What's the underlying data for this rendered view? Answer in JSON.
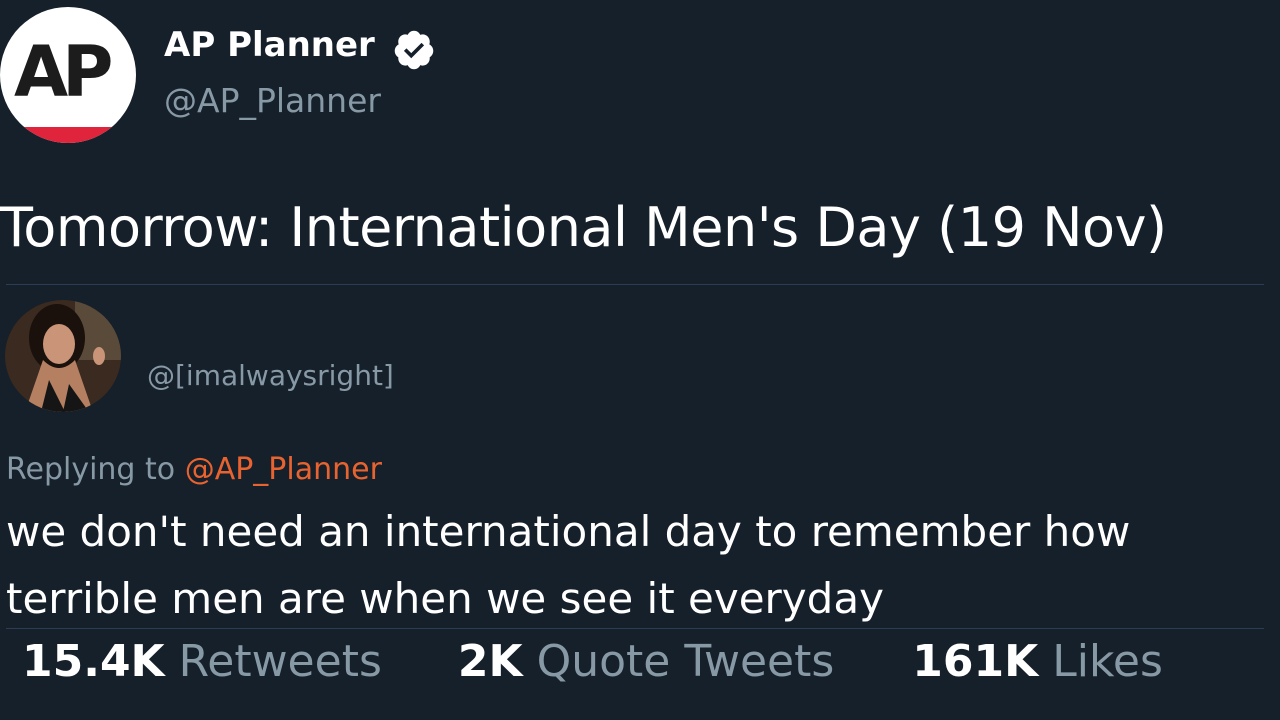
{
  "author": {
    "logo_text": "AP",
    "display_name": "AP Planner",
    "handle": "@AP_Planner",
    "verified_icon": "verified-badge-icon"
  },
  "tweet": {
    "text": "Tomorrow: International Men's Day (19 Nov)"
  },
  "reply": {
    "handle": "@[imalwaysright]",
    "replying_prefix": "Replying to",
    "replying_mention": "@AP_Planner",
    "line1": "we don't need an international day to remember how",
    "line2": "terrible men are when we see it everyday"
  },
  "stats": {
    "retweets_value": "15.4K",
    "retweets_label": "Retweets",
    "quotes_value": "2K",
    "quotes_label": "Quote Tweets",
    "likes_value": "161K",
    "likes_label": "Likes"
  },
  "colors": {
    "background": "#15202b",
    "secondary_text": "#8899a6",
    "mention": "#e8632f",
    "ap_red": "#e0243b"
  }
}
